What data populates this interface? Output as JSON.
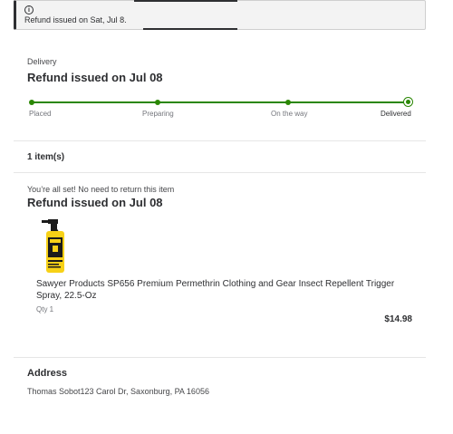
{
  "alert": {
    "icon": "info-icon",
    "text": "Refund issued on Sat, Jul 8."
  },
  "delivery": {
    "label": "Delivery",
    "status_title": "Refund issued on Jul 08",
    "steps": [
      "Placed",
      "Preparing",
      "On the way",
      "Delivered"
    ],
    "accent_color": "#2a8703"
  },
  "items": {
    "count_label": "1 item(s)",
    "note": "You’re all set! No need to return this item",
    "status_title": "Refund issued on Jul 08",
    "product": {
      "name": "Sawyer Products SP656 Premium Permethrin Clothing and Gear Insect Repellent Trigger Spray, 22.5-Oz",
      "qty": "Qty 1",
      "price": "$14.98",
      "image_icon": "spray-bottle-image"
    }
  },
  "address": {
    "title": "Address",
    "text": "Thomas Sobot123 Carol Dr, Saxonburg, PA 16056"
  }
}
